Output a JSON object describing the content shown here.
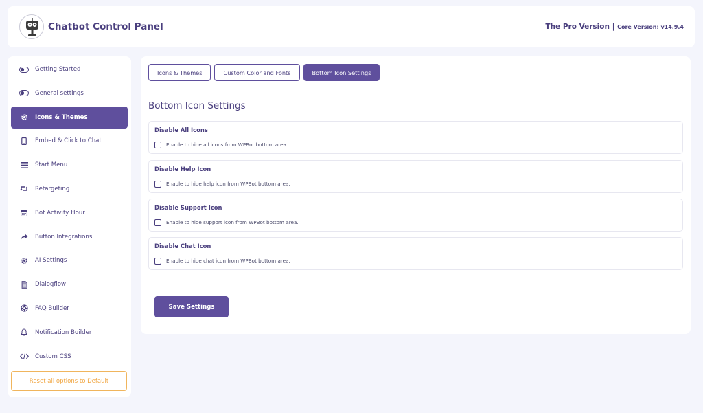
{
  "header": {
    "title": "Chatbot Control Panel",
    "pro_label": "The Pro Version",
    "separator": "|",
    "core_version": "Core Version: v14.9.4",
    "logo_icon": "robot-logo-icon"
  },
  "sidebar": {
    "items": [
      {
        "label": "Getting Started",
        "icon": "toggle-icon"
      },
      {
        "label": "General settings",
        "icon": "toggle-icon"
      },
      {
        "label": "Icons & Themes",
        "icon": "gear-icon",
        "active": true
      },
      {
        "label": "Embed & Click to Chat",
        "icon": "mobile-icon"
      },
      {
        "label": "Start Menu",
        "icon": "menu-bars-icon"
      },
      {
        "label": "Retargeting",
        "icon": "retweet-icon"
      },
      {
        "label": "Bot Activity Hour",
        "icon": "calendar-icon"
      },
      {
        "label": "Button Integrations",
        "icon": "share-arrow-icon"
      },
      {
        "label": "AI Settings",
        "icon": "gear-icon"
      },
      {
        "label": "Dialogflow",
        "icon": "document-icon"
      },
      {
        "label": "FAQ Builder",
        "icon": "life-ring-icon"
      },
      {
        "label": "Notification Builder",
        "icon": "bell-icon"
      },
      {
        "label": "Custom CSS",
        "icon": "code-icon"
      }
    ],
    "reset_label": "Reset all options to Default"
  },
  "main": {
    "tabs": [
      {
        "label": "Icons & Themes"
      },
      {
        "label": "Custom Color and Fonts"
      },
      {
        "label": "Bottom Icon Settings",
        "active": true
      }
    ],
    "section_title": "Bottom Icon Settings",
    "options": [
      {
        "title": "Disable All Icons",
        "description": "Enable to hide all icons from WPBot bottom area.",
        "checked": false
      },
      {
        "title": "Disable Help Icon",
        "description": "Enable to hide help icon from WPBot bottom area.",
        "checked": false
      },
      {
        "title": "Disable Support Icon",
        "description": "Enable to hide support icon from WPBot bottom area.",
        "checked": false
      },
      {
        "title": "Disable Chat Icon",
        "description": "Enable to hide chat icon from WPBot bottom area.",
        "checked": false
      }
    ],
    "save_label": "Save Settings"
  },
  "colors": {
    "accent": "#5f4f9d",
    "text": "#4a3f7e",
    "reset_border": "#f0b55d",
    "background": "#f4f5fc"
  }
}
